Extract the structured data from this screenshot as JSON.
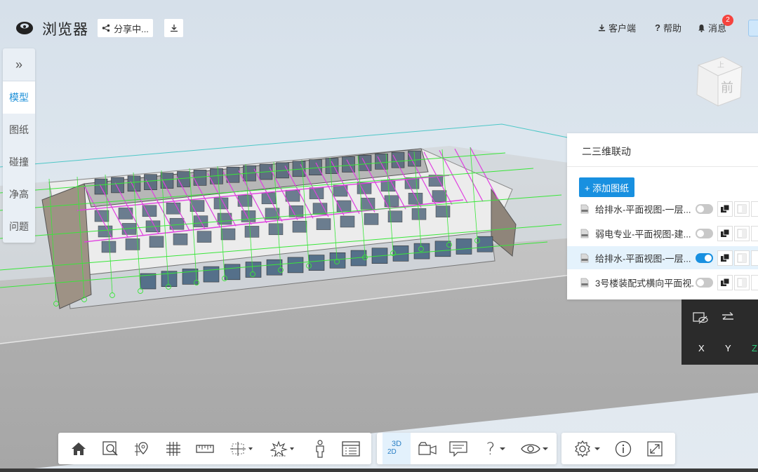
{
  "app": {
    "title": "浏览器"
  },
  "header": {
    "share_label": "分享中...",
    "client_label": "客户端",
    "help_label": "帮助",
    "messages_label": "消息",
    "messages_count": "2"
  },
  "sidenav": {
    "collapse_glyph": "»",
    "items": [
      {
        "label": "模型",
        "active": true
      },
      {
        "label": "图纸",
        "active": false
      },
      {
        "label": "碰撞",
        "active": false
      },
      {
        "label": "净高",
        "active": false
      },
      {
        "label": "问题",
        "active": false
      }
    ]
  },
  "viewcube": {
    "front": "前",
    "top": "上"
  },
  "linkage_panel": {
    "title": "二三维联动",
    "add_button": "+ 添加图纸",
    "drawings": [
      {
        "name": "给排水-平面视图-一层...",
        "enabled": false,
        "selected": false
      },
      {
        "name": "弱电专业-平面视图-建...",
        "enabled": false,
        "selected": false
      },
      {
        "name": "给排水-平面视图-一层...",
        "enabled": true,
        "selected": true
      },
      {
        "name": "3号楼装配式横向平面视...",
        "enabled": false,
        "selected": false
      }
    ]
  },
  "axis_panel": {
    "x": "X",
    "y": "Y",
    "z": "Z"
  },
  "toolbar": {
    "view_mode": {
      "top": "3D",
      "bottom": "2D"
    },
    "icons": [
      "home-icon",
      "zoom-window-icon",
      "location-pin-icon",
      "grid-icon",
      "ruler-icon",
      "section-box-icon",
      "explode-icon",
      "person-icon",
      "properties-icon",
      "view-mode-icon",
      "camera-icon",
      "comment-icon",
      "help-icon",
      "eye-icon",
      "settings-icon",
      "info-icon",
      "fullscreen-icon"
    ]
  },
  "colors": {
    "accent": "#1890e0",
    "badge": "#f5433e",
    "pipe_green": "#39e639",
    "pipe_magenta": "#e040e0"
  }
}
